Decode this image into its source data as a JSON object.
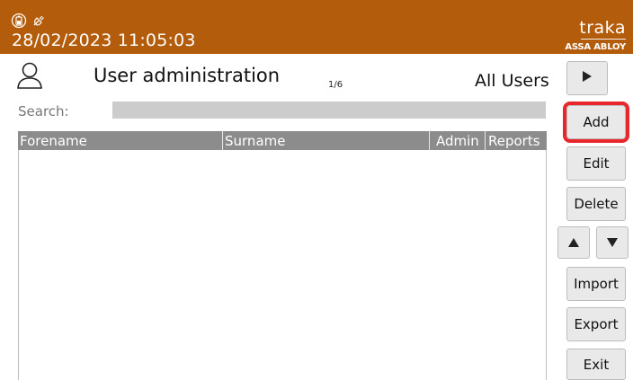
{
  "header": {
    "datetime": "28/02/2023 11:05:03",
    "status_icons": [
      "battery-icon",
      "power-plug-icon"
    ],
    "brand": {
      "logo": "traka",
      "sub": "ASSA ABLOY"
    },
    "background_color": "#b35c0b"
  },
  "page": {
    "title": "User administration",
    "page_counter": "1/6",
    "filter": "All Users"
  },
  "search": {
    "label": "Search:",
    "value": ""
  },
  "table": {
    "columns": [
      "Forename",
      "Surname",
      "Admin",
      "Reports"
    ],
    "rows": []
  },
  "rail": {
    "next_icon": "play-right-icon",
    "add": "Add",
    "edit": "Edit",
    "delete": "Delete",
    "up_icon": "triangle-up-icon",
    "down_icon": "triangle-down-icon",
    "import": "Import",
    "export": "Export",
    "exit": "Exit"
  },
  "highlight_color": "#e8262c"
}
